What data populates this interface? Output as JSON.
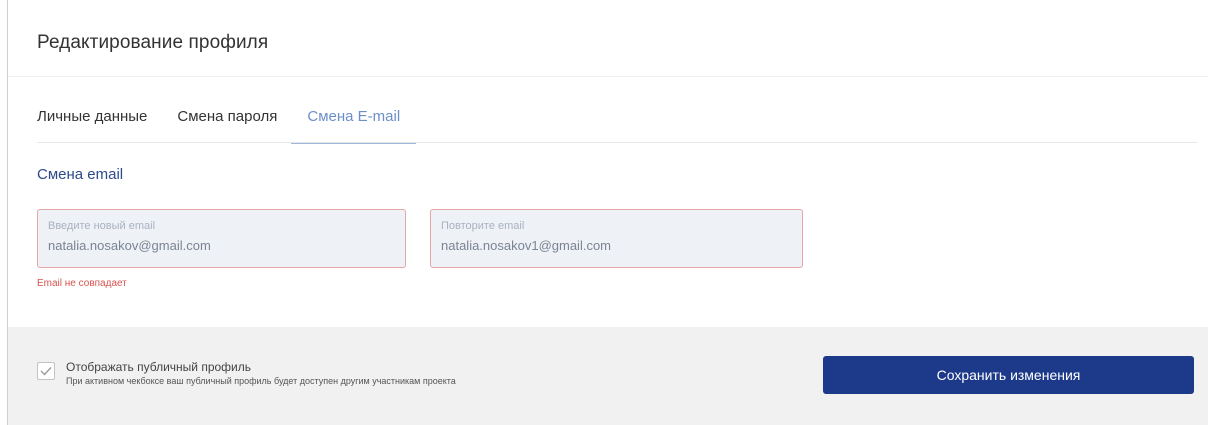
{
  "card": {
    "title": "Редактирование профиля"
  },
  "tabs": [
    {
      "label": "Личные данные",
      "active": false
    },
    {
      "label": "Смена пароля",
      "active": false
    },
    {
      "label": "Смена E-mail",
      "active": true
    }
  ],
  "section": {
    "title": "Смена email"
  },
  "fields": {
    "new_email": {
      "label": "Введите новый email",
      "value": "natalia.nosakov@gmail.com"
    },
    "repeat_email": {
      "label": "Повторите email",
      "value": "natalia.nosakov1@gmail.com"
    }
  },
  "error": {
    "text": "Email не совпадает"
  },
  "footer": {
    "public_profile_label": "Отображать публичный профиль",
    "public_profile_hint": "При активном чекбоксе ваш публичный профиль будет доступен другим участникам проекта",
    "public_profile_checked": true,
    "save_label": "Сохранить изменения"
  },
  "colors": {
    "accent": "#1d3a8a",
    "tab_active": "#6b8fc8",
    "error": "#d9534f",
    "field_bg": "#eef1f6",
    "field_border_error": "#e5a6a6"
  }
}
